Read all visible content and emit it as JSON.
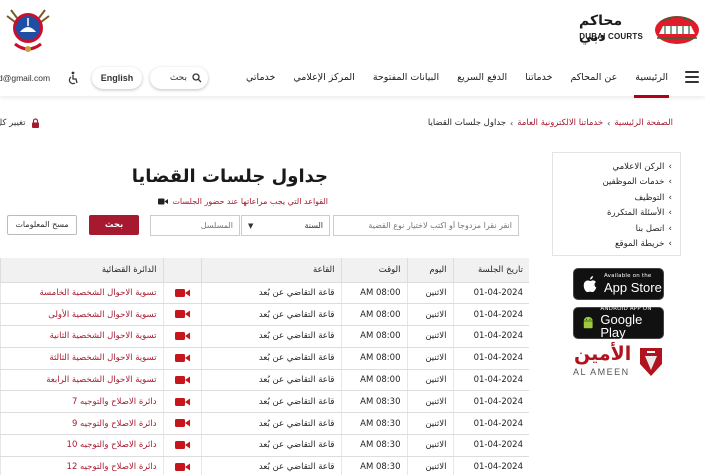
{
  "header": {
    "courts_name_ar": "محاكم دبي",
    "courts_name_en": "DUBAI COURTS"
  },
  "nav": {
    "items": [
      "الرئيسية",
      "عن المحاكم",
      "خدماتنا",
      "الدفع السريع",
      "البيانات المفتوحة",
      "المركز الإعلامي",
      "خدماتي"
    ],
    "search_label": "بحث",
    "language": "English",
    "user_email": "d@gmail.com"
  },
  "breadcrumb": {
    "home": "الصفحة الرئيسية",
    "section": "خدماتنا الالكترونية العامة",
    "current": "جداول جلسات القضايا"
  },
  "account": {
    "change_password": "تغيير كل"
  },
  "side_menu": {
    "items": [
      "الركن الاعلامي",
      "خدمات الموظفين",
      "التوظيف",
      "الأسئلة المتكررة",
      "اتصل بنا",
      "خريطة الموقع"
    ]
  },
  "stores": {
    "appstore_small": "Available on the",
    "appstore_big": "App Store",
    "gplay_small": "ANDROID APP ON",
    "gplay_big": "Google Play",
    "alameen_ar": "الأمين",
    "alameen_en": "AL AMEEN"
  },
  "page": {
    "title": "جداول جلسات القضايا",
    "rules_link": "القواعد التي يجب مراعاتها عند حضور الجلسات"
  },
  "filters": {
    "case_placeholder": "انقر نقراً مزدوجاً أو اكتب لاختيار نوع القضية",
    "year_label": "السنة",
    "serial_placeholder": "المسلسل",
    "search_button": "بحث",
    "clear_button": "مسح المعلومات"
  },
  "table": {
    "headers": {
      "date": "تاريخ الجلسة",
      "day": "اليوم",
      "time": "الوقت",
      "hall": "القاعة",
      "court": "الدائرة القضائية"
    },
    "rows": [
      {
        "date": "01-04-2024",
        "day": "الاثنين",
        "time": "AM 08:00",
        "hall": "قاعة التقاضي عن بُعد",
        "court": "تسوية الاحوال الشخصية الخامسة"
      },
      {
        "date": "01-04-2024",
        "day": "الاثنين",
        "time": "AM 08:00",
        "hall": "قاعة التقاضي عن بُعد",
        "court": "تسوية الاحوال الشخصية الأولى"
      },
      {
        "date": "01-04-2024",
        "day": "الاثنين",
        "time": "AM 08:00",
        "hall": "قاعة التقاضي عن بُعد",
        "court": "تسوية الاحوال الشخصية الثانية"
      },
      {
        "date": "01-04-2024",
        "day": "الاثنين",
        "time": "AM 08:00",
        "hall": "قاعة التقاضي عن بُعد",
        "court": "تسوية الاحوال الشخصية الثالثة"
      },
      {
        "date": "01-04-2024",
        "day": "الاثنين",
        "time": "AM 08:00",
        "hall": "قاعة التقاضي عن بُعد",
        "court": "تسوية الاحوال الشخصية الرابعة"
      },
      {
        "date": "01-04-2024",
        "day": "الاثنين",
        "time": "AM 08:30",
        "hall": "قاعة التقاضي عن بُعد",
        "court": "دائرة الاصلاح والتوجيه 7"
      },
      {
        "date": "01-04-2024",
        "day": "الاثنين",
        "time": "AM 08:30",
        "hall": "قاعة التقاضي عن بُعد",
        "court": "دائرة الاصلاح والتوجيه 9"
      },
      {
        "date": "01-04-2024",
        "day": "الاثنين",
        "time": "AM 08:30",
        "hall": "قاعة التقاضي عن بُعد",
        "court": "دائرة الاصلاح والتوجيه 10"
      },
      {
        "date": "01-04-2024",
        "day": "الاثنين",
        "time": "AM 08:30",
        "hall": "قاعة التقاضي عن بُعد",
        "court": "دائرة الاصلاح والتوجيه 12"
      }
    ]
  },
  "colors": {
    "brand_red": "#a6192e",
    "nav_active": "#b1001a",
    "header_bg": "#f1f1f1"
  }
}
